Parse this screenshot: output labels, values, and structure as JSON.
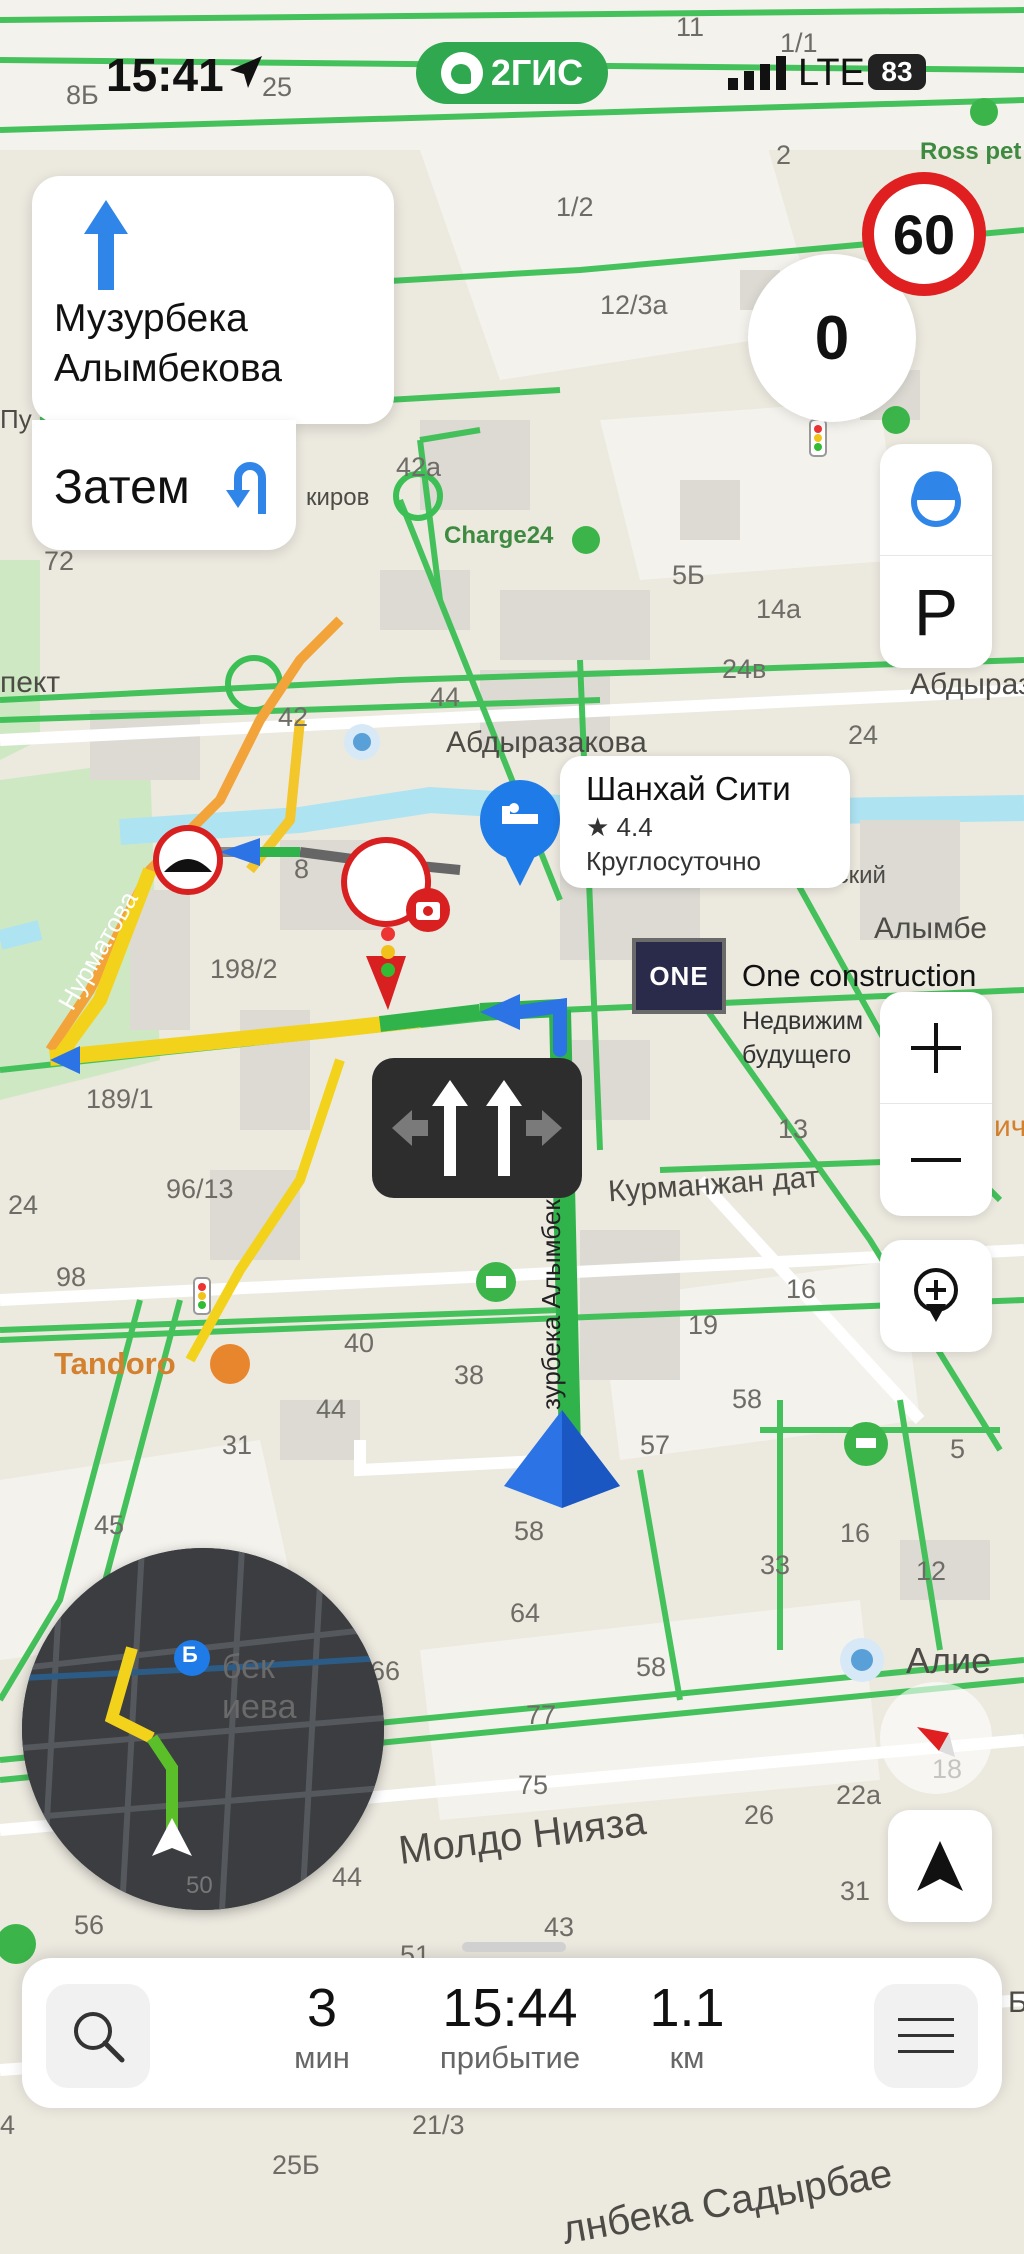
{
  "status_bar": {
    "time": "15:41",
    "app_badge": "2ГИС",
    "network": "LTE",
    "battery": "83"
  },
  "maneuver": {
    "street_line1": "Музурбека",
    "street_line2": "Алымбекова",
    "then_label": "Затем"
  },
  "speed": {
    "limit": "60",
    "current": "0"
  },
  "poi": {
    "name": "Шанхай Сити",
    "rating": "★ 4.4",
    "hours": "Круглосуточно"
  },
  "ad": {
    "logo_text": "ONE",
    "name": "One construction",
    "line1": "Недвижим",
    "line2": "будущего"
  },
  "map_labels": {
    "street_abdyrazakova": "Абдыразакова",
    "street_abdyraz_right": "Абдыраз",
    "street_kurmanzhan": "Курманжан дат",
    "street_moldo": "Молдо Нияза",
    "street_alymbe": "Алымбе",
    "street_aliev": "Алие",
    "street_nurmatova": "Нурматова",
    "street_muz_alym_vertical": "зурбека Алымбекова",
    "street_sadyrbae": "лнбека Садырбае",
    "street_pjekt": "пект",
    "street_kirov": "киров",
    "street_pu": "Пу",
    "street_enskiy": "енский",
    "street_ich": "ич",
    "street_b": "Б",
    "charge": "Charge24",
    "ross": "Ross pet",
    "tandoor": "Tandoro",
    "minimap_marker": "Б",
    "minimap_text1": "бек",
    "minimap_text2": "иева",
    "minimap_50": "50",
    "numbers": [
      "8Б",
      "25",
      "11",
      "1/1",
      "2",
      "1/2",
      "12/3а",
      "42а",
      "72",
      "5Б",
      "14а",
      "24в",
      "44",
      "42",
      "24",
      "8",
      "198/2",
      "189/1",
      "96/13",
      "13",
      "16",
      "19",
      "24",
      "98",
      "40",
      "38",
      "44",
      "31",
      "57",
      "58",
      "5",
      "45",
      "58",
      "16",
      "33",
      "12",
      "64",
      "66",
      "58",
      "77",
      "75",
      "26",
      "22а",
      "31",
      "44",
      "43",
      "56",
      "51",
      "4",
      "21/3",
      "25Б",
      "18"
    ]
  },
  "bottom": {
    "time_value": "3",
    "time_unit": "мин",
    "arrival_value": "15:44",
    "arrival_unit": "прибытие",
    "distance_value": "1.1",
    "distance_unit": "км"
  },
  "colors": {
    "route_green": "#2fb34a",
    "route_yellow": "#f3d21c",
    "accent_blue": "#1f7be8",
    "speed_red": "#e02020"
  }
}
